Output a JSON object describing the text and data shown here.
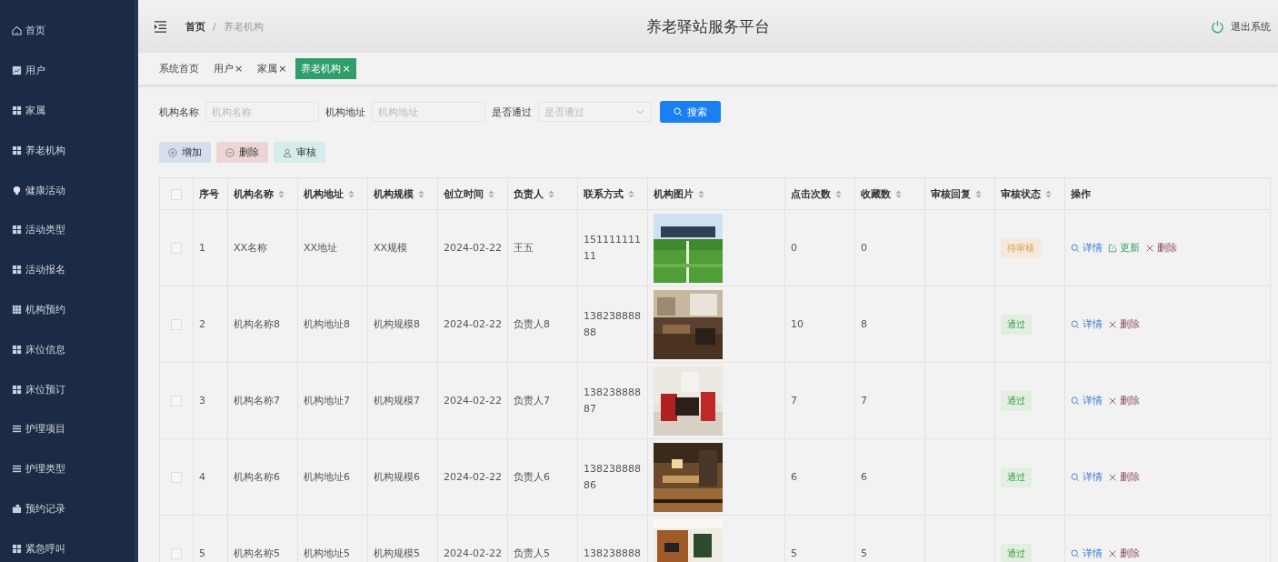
{
  "sidebar": {
    "items": [
      {
        "label": "首页"
      },
      {
        "label": "用户"
      },
      {
        "label": "家属"
      },
      {
        "label": "养老机构"
      },
      {
        "label": "健康活动"
      },
      {
        "label": "活动类型"
      },
      {
        "label": "活动报名"
      },
      {
        "label": "机构预约"
      },
      {
        "label": "床位信息"
      },
      {
        "label": "床位预订"
      },
      {
        "label": "护理项目"
      },
      {
        "label": "护理类型"
      },
      {
        "label": "预约记录"
      },
      {
        "label": "紧急呼叫"
      }
    ]
  },
  "header": {
    "breadcrumb": [
      "首页",
      "养老机构"
    ],
    "separator": "/",
    "title": "养老驿站服务平台",
    "logout": "退出系统"
  },
  "tabs": [
    {
      "label": "系统首页",
      "selected": false
    },
    {
      "label": "用户",
      "close": "×",
      "selected": false
    },
    {
      "label": "家属",
      "close": "×",
      "selected": false
    },
    {
      "label": "养老机构",
      "close": "×",
      "selected": true
    }
  ],
  "search": {
    "fields": [
      {
        "label": "机构名称",
        "placeholder": "机构名称",
        "kind": "input"
      },
      {
        "label": "机构地址",
        "placeholder": "机构地址",
        "kind": "input"
      },
      {
        "label": "是否通过",
        "placeholder": "是否通过",
        "kind": "select"
      }
    ],
    "button": "搜索"
  },
  "actions": [
    {
      "label": "增加",
      "kind": "add"
    },
    {
      "label": "删除",
      "kind": "delete"
    },
    {
      "label": "审核",
      "kind": "audit"
    }
  ],
  "table": {
    "all_checked": false,
    "columns": [
      {
        "label": "序号",
        "sortable": false
      },
      {
        "label": "机构名称",
        "sortable": true
      },
      {
        "label": "机构地址",
        "sortable": true
      },
      {
        "label": "机构规模",
        "sortable": true
      },
      {
        "label": "创立时间",
        "sortable": true
      },
      {
        "label": "负责人",
        "sortable": true
      },
      {
        "label": "联系方式",
        "sortable": true
      },
      {
        "label": "机构图片",
        "sortable": true
      },
      {
        "label": "点击次数",
        "sortable": true
      },
      {
        "label": "收藏数",
        "sortable": true
      },
      {
        "label": "审核回复",
        "sortable": true
      },
      {
        "label": "审核状态",
        "sortable": true
      },
      {
        "label": "操作",
        "sortable": false
      }
    ],
    "rows": [
      {
        "checked": false,
        "cells": [
          "1",
          "XX名称",
          "XX地址",
          "XX规模",
          "2024-02-22",
          "王五",
          "15111111111"
        ],
        "picture": {
          "kind": "picture"
        },
        "clicks": "0",
        "favorites": "0",
        "status": {
          "text": "待审核",
          "kind": "pending"
        },
        "ops": [
          {
            "label": "详情",
            "kind": "detail"
          },
          {
            "label": "更新",
            "kind": "update"
          },
          {
            "label": "删除",
            "kind": "delete"
          }
        ]
      },
      {
        "checked": false,
        "cells": [
          "2",
          "机构名称8",
          "机构地址8",
          "机构规模8",
          "2024-02-22",
          "负责人8",
          "13823888888"
        ],
        "picture": {
          "kind": "picture"
        },
        "clicks": "10",
        "favorites": "8",
        "status": {
          "text": "通过",
          "kind": "passed"
        },
        "ops": [
          {
            "label": "详情",
            "kind": "detail"
          },
          {
            "label": "删除",
            "kind": "delete"
          }
        ]
      },
      {
        "checked": false,
        "cells": [
          "3",
          "机构名称7",
          "机构地址7",
          "机构规模7",
          "2024-02-22",
          "负责人7",
          "13823888887"
        ],
        "picture": {
          "kind": "picture"
        },
        "clicks": "7",
        "favorites": "7",
        "status": {
          "text": "通过",
          "kind": "passed"
        },
        "ops": [
          {
            "label": "详情",
            "kind": "detail"
          },
          {
            "label": "删除",
            "kind": "delete"
          }
        ]
      },
      {
        "checked": false,
        "cells": [
          "4",
          "机构名称6",
          "机构地址6",
          "机构规模6",
          "2024-02-22",
          "负责人6",
          "13823888886"
        ],
        "picture": {
          "kind": "picture"
        },
        "clicks": "6",
        "favorites": "6",
        "status": {
          "text": "通过",
          "kind": "passed"
        },
        "ops": [
          {
            "label": "详情",
            "kind": "detail"
          },
          {
            "label": "删除",
            "kind": "delete"
          }
        ]
      },
      {
        "checked": false,
        "cells": [
          "5",
          "机构名称5",
          "机构地址5",
          "机构规模5",
          "2024-02-22",
          "负责人5",
          "138238888"
        ],
        "picture": {
          "kind": "picture"
        },
        "clicks": "5",
        "favorites": "5",
        "status": {
          "text": "通过",
          "kind": "passed"
        },
        "ops": [
          {
            "label": "详情",
            "kind": "detail"
          },
          {
            "label": "删除",
            "kind": "delete"
          }
        ]
      }
    ]
  }
}
